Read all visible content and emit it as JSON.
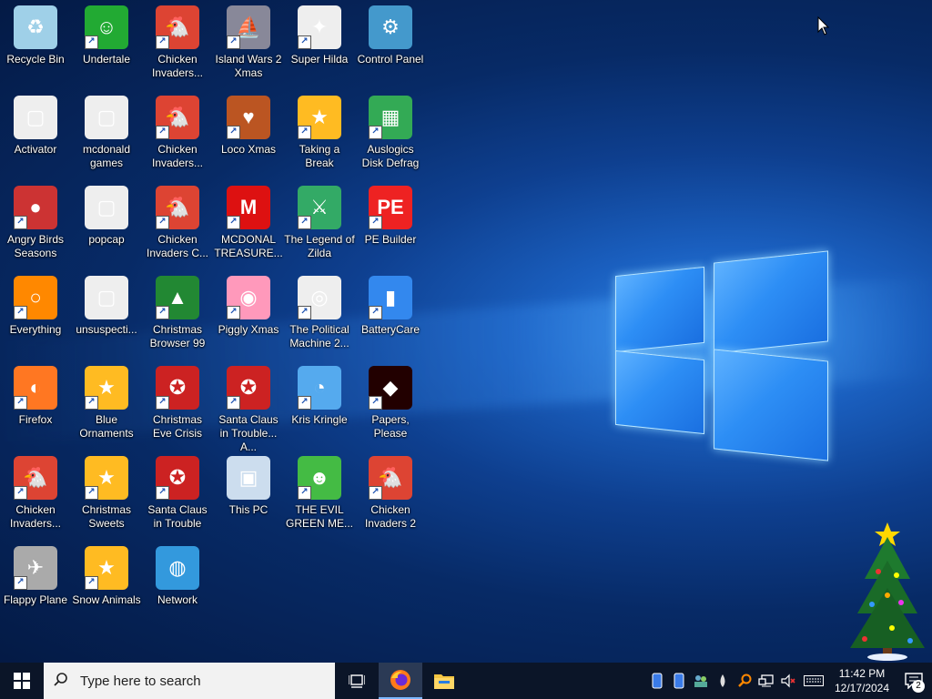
{
  "desktop": {
    "icons": [
      {
        "label": "Recycle Bin",
        "icon": "recycle-bin-icon"
      },
      {
        "label": "Undertale",
        "icon": "undertale-icon"
      },
      {
        "label": "Chicken Invaders...",
        "icon": "chicken-invaders-icon"
      },
      {
        "label": "Island Wars 2 Xmas",
        "icon": "island-wars-icon"
      },
      {
        "label": "Super Hilda",
        "icon": "super-hilda-icon"
      },
      {
        "label": "Control Panel",
        "icon": "control-panel-icon"
      },
      {
        "label": "Activator",
        "icon": "folder-icon"
      },
      {
        "label": "mcdonald games",
        "icon": "folder-icon"
      },
      {
        "label": "Chicken Invaders...",
        "icon": "chicken-invaders-icon"
      },
      {
        "label": "Loco Xmas",
        "icon": "loco-xmas-icon"
      },
      {
        "label": "Taking a Break",
        "icon": "game-star-icon"
      },
      {
        "label": "Auslogics Disk Defrag",
        "icon": "disk-defrag-icon"
      },
      {
        "label": "Angry Birds Seasons",
        "icon": "angry-birds-icon"
      },
      {
        "label": "popcap",
        "icon": "folder-icon"
      },
      {
        "label": "Chicken Invaders C...",
        "icon": "chicken-invaders-icon"
      },
      {
        "label": "MCDONAL TREASURE...",
        "icon": "mcdonalds-icon"
      },
      {
        "label": "The Legend of Zilda",
        "icon": "zilda-icon"
      },
      {
        "label": "PE Builder",
        "icon": "pe-builder-icon"
      },
      {
        "label": "Everything",
        "icon": "search-magnifier-icon"
      },
      {
        "label": "unsuspecti...",
        "icon": "folder-icon"
      },
      {
        "label": "Christmas Browser 99",
        "icon": "christmas-tree-icon"
      },
      {
        "label": "Piggly Xmas",
        "icon": "pig-icon"
      },
      {
        "label": "The Political Machine 2...",
        "icon": "political-machine-icon"
      },
      {
        "label": "BatteryCare",
        "icon": "battery-icon"
      },
      {
        "label": "Firefox",
        "icon": "firefox-icon"
      },
      {
        "label": "Blue Ornaments",
        "icon": "game-star-icon"
      },
      {
        "label": "Christmas Eve Crisis",
        "icon": "santa-icon"
      },
      {
        "label": "Santa Claus in Trouble... A...",
        "icon": "santa-icon"
      },
      {
        "label": "Kris Kringle",
        "icon": "kris-kringle-icon"
      },
      {
        "label": "Papers, Please",
        "icon": "papers-please-icon"
      },
      {
        "label": "Chicken Invaders...",
        "icon": "chicken-invaders-icon"
      },
      {
        "label": "Christmas Sweets",
        "icon": "game-star-icon"
      },
      {
        "label": "Santa Claus in Trouble",
        "icon": "santa-icon"
      },
      {
        "label": "This PC",
        "icon": "computer-icon"
      },
      {
        "label": "THE EVIL GREEN ME...",
        "icon": "messenger-icon"
      },
      {
        "label": "Chicken Invaders 2",
        "icon": "chicken-invaders-icon"
      },
      {
        "label": "Flappy Plane",
        "icon": "flappy-plane-icon"
      },
      {
        "label": "Snow Animals",
        "icon": "game-star-icon"
      },
      {
        "label": "Network",
        "icon": "network-globe-icon"
      }
    ]
  },
  "taskbar": {
    "search_placeholder": "Type here to search",
    "clock_time": "11:42 PM",
    "clock_date": "12/17/2024",
    "notification_count": "2"
  }
}
